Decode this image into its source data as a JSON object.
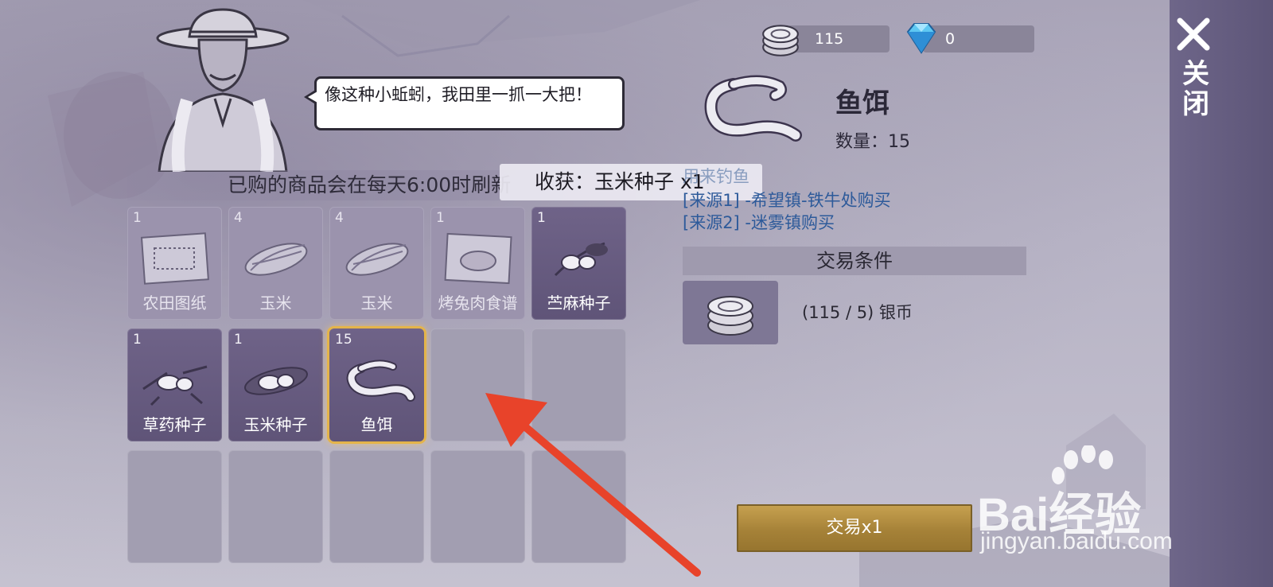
{
  "close_bar": {
    "label": "关闭"
  },
  "currency": {
    "silver": {
      "icon": "silver-coin-icon",
      "value": "115"
    },
    "diamond": {
      "icon": "diamond-icon",
      "value": "0"
    }
  },
  "npc": {
    "speech": "像这种小蚯蚓，我田里一抓一大把！"
  },
  "refresh_notice": "已购的商品会在每天6:00时刷新",
  "toast": "收获：玉米种子 x1",
  "items": [
    {
      "count": "1",
      "name": "农田图纸",
      "state": "faded",
      "icon": "blueprint-icon"
    },
    {
      "count": "4",
      "name": "玉米",
      "state": "faded",
      "icon": "corn-icon"
    },
    {
      "count": "4",
      "name": "玉米",
      "state": "faded",
      "icon": "corn-icon"
    },
    {
      "count": "1",
      "name": "烤兔肉食谱",
      "state": "faded",
      "icon": "recipe-icon"
    },
    {
      "count": "1",
      "name": "苎麻种子",
      "state": "owned",
      "icon": "seed-icon"
    },
    {
      "count": "1",
      "name": "草药种子",
      "state": "owned",
      "icon": "herb-seed-icon"
    },
    {
      "count": "1",
      "name": "玉米种子",
      "state": "owned",
      "icon": "corn-seed-icon"
    },
    {
      "count": "15",
      "name": "鱼饵",
      "state": "selected",
      "icon": "worm-icon"
    }
  ],
  "detail": {
    "name": "鱼饵",
    "qty_label": "数量：",
    "qty": "15",
    "source_title": "用来钓鱼",
    "sources": [
      "[来源1] -希望镇-铁牛处购买",
      "[来源2] -迷雾镇购买"
    ],
    "condition_header": "交易条件",
    "condition_text": "(115 / 5) 银币"
  },
  "trade_button": "交易x1",
  "watermark": {
    "line1": "Bai经验",
    "line2": "jingyan.baidu.com"
  },
  "colors": {
    "accent_gold": "#c6a04f",
    "selected_glow": "#e4b44a",
    "arrow": "#e8432a"
  }
}
